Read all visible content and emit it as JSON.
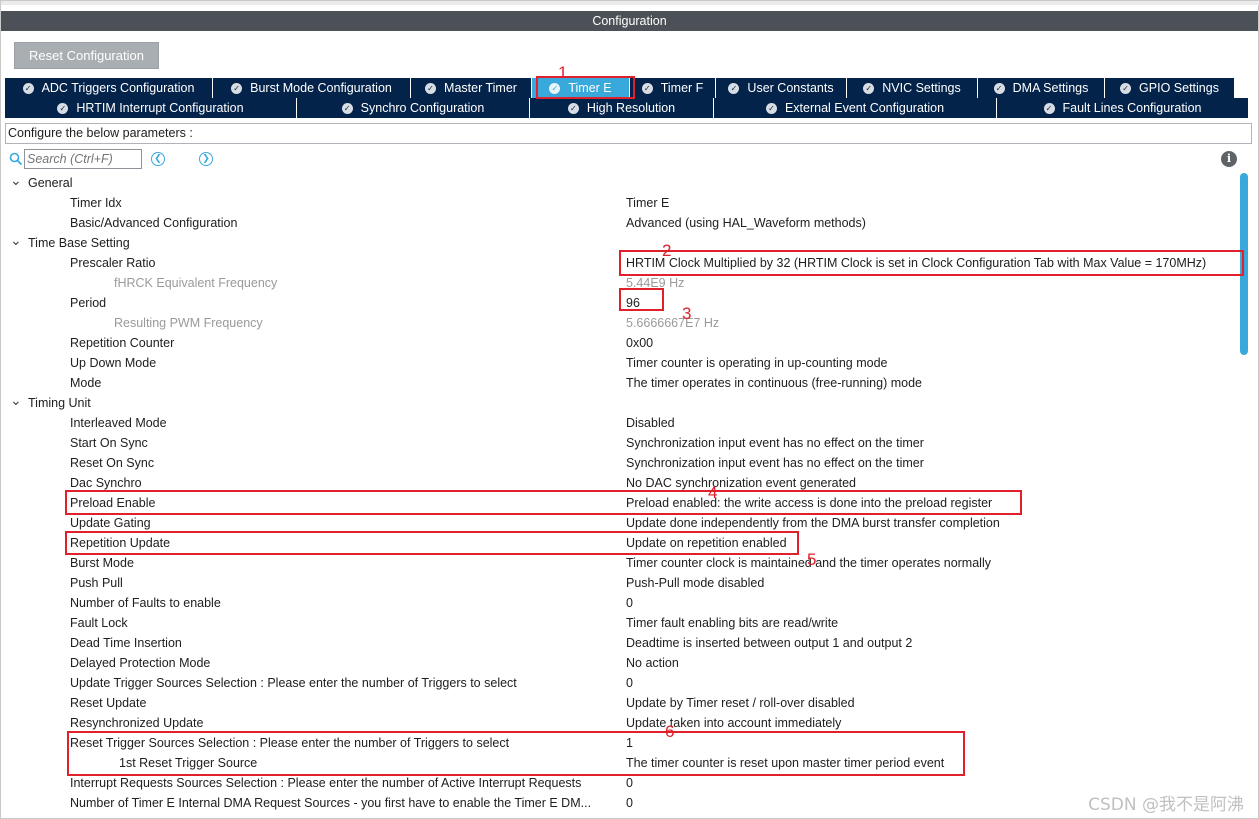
{
  "window": {
    "title": "Configuration"
  },
  "toolbar": {
    "reset_label": "Reset Configuration"
  },
  "tabs_row1": [
    {
      "label": "ADC Triggers Configuration",
      "w": 208,
      "active": false
    },
    {
      "label": "Burst Mode Configuration",
      "w": 198,
      "active": false
    },
    {
      "label": "Master Timer",
      "w": 121,
      "active": false
    },
    {
      "label": "Timer E",
      "w": 98,
      "active": true
    },
    {
      "label": "Timer F",
      "w": 86,
      "active": false
    },
    {
      "label": "User Constants",
      "w": 131,
      "active": false
    },
    {
      "label": "NVIC Settings",
      "w": 131,
      "active": false
    },
    {
      "label": "DMA Settings",
      "w": 127,
      "active": false
    },
    {
      "label": "GPIO Settings",
      "w": 130,
      "active": false
    }
  ],
  "tabs_row2": [
    {
      "label": "HRTIM Interrupt Configuration",
      "w": 292
    },
    {
      "label": "Synchro Configuration",
      "w": 233
    },
    {
      "label": "High Resolution",
      "w": 184
    },
    {
      "label": "External Event Configuration",
      "w": 283
    },
    {
      "label": "Fault Lines Configuration",
      "w": 252
    }
  ],
  "configure_text": "Configure the below parameters :",
  "search": {
    "placeholder": "Search (Ctrl+F)"
  },
  "icons": {
    "back": "chevron-left-icon",
    "forward": "chevron-right-icon",
    "info": "info-icon",
    "search": "search-icon",
    "check": "check-icon"
  },
  "colors": {
    "tab_bg": "#03234b",
    "tab_active": "#39a9dc",
    "title_bg": "#4b5157",
    "annotation": "#e0202a"
  },
  "rows": [
    {
      "type": "group",
      "label": "General"
    },
    {
      "type": "param",
      "level": 1,
      "label": "Timer Idx",
      "value": "Timer E"
    },
    {
      "type": "param",
      "level": 1,
      "label": "Basic/Advanced Configuration",
      "value": "Advanced (using HAL_Waveform methods)"
    },
    {
      "type": "group",
      "label": "Time Base Setting"
    },
    {
      "type": "param",
      "level": 1,
      "label": "Prescaler Ratio",
      "value": "HRTIM Clock Multiplied by 32 (HRTIM Clock is set in Clock Configuration Tab with Max Value = 170MHz)"
    },
    {
      "type": "param",
      "level": 2,
      "grey": true,
      "label": "fHRCK Equivalent Frequency",
      "value": "5.44E9 Hz"
    },
    {
      "type": "param",
      "level": 1,
      "label": "Period",
      "value": "96"
    },
    {
      "type": "param",
      "level": 2,
      "grey": true,
      "label": "Resulting PWM Frequency",
      "value": "5.6666667E7 Hz"
    },
    {
      "type": "param",
      "level": 1,
      "label": "Repetition Counter",
      "value": "0x00"
    },
    {
      "type": "param",
      "level": 1,
      "label": "Up Down Mode",
      "value": "Timer counter is operating in up-counting mode"
    },
    {
      "type": "param",
      "level": 1,
      "label": "Mode",
      "value": "The timer operates in continuous (free-running) mode"
    },
    {
      "type": "group",
      "label": "Timing Unit"
    },
    {
      "type": "param",
      "level": 1,
      "label": "Interleaved Mode",
      "value": "Disabled"
    },
    {
      "type": "param",
      "level": 1,
      "label": "Start On Sync",
      "value": "Synchronization input event has no effect on the timer"
    },
    {
      "type": "param",
      "level": 1,
      "label": "Reset On Sync",
      "value": "Synchronization input event has no effect on the timer"
    },
    {
      "type": "param",
      "level": 1,
      "label": "Dac Synchro",
      "value": "No DAC synchronization event generated"
    },
    {
      "type": "param",
      "level": 1,
      "label": "Preload Enable",
      "value": "Preload enabled: the write access is done into the preload register"
    },
    {
      "type": "param",
      "level": 1,
      "label": "Update Gating",
      "value": "Update done independently from the DMA burst transfer completion"
    },
    {
      "type": "param",
      "level": 1,
      "label": "Repetition Update",
      "value": "Update on repetition enabled"
    },
    {
      "type": "param",
      "level": 1,
      "label": "Burst Mode",
      "value": "Timer counter clock is maintained and the timer operates normally"
    },
    {
      "type": "param",
      "level": 1,
      "label": "Push Pull",
      "value": "Push-Pull mode disabled"
    },
    {
      "type": "param",
      "level": 1,
      "label": "Number of Faults to enable",
      "value": "0"
    },
    {
      "type": "param",
      "level": 1,
      "label": "Fault Lock",
      "value": "Timer fault enabling bits are read/write"
    },
    {
      "type": "param",
      "level": 1,
      "label": "Dead Time Insertion",
      "value": "Deadtime is inserted between output 1 and output 2"
    },
    {
      "type": "param",
      "level": 1,
      "label": "Delayed Protection Mode",
      "value": "No action"
    },
    {
      "type": "param",
      "level": 1,
      "label": "Update Trigger Sources Selection : Please enter the number of Triggers to select",
      "value": "0"
    },
    {
      "type": "param",
      "level": 1,
      "label": "Reset Update",
      "value": "Update by Timer reset / roll-over disabled"
    },
    {
      "type": "param",
      "level": 1,
      "label": "Resynchronized Update",
      "value": "Update taken into account immediately"
    },
    {
      "type": "param",
      "level": 1,
      "label": "Reset Trigger Sources Selection : Please enter the number of Triggers to select",
      "value": "1"
    },
    {
      "type": "param",
      "level": 2,
      "label": "1st Reset Trigger Source",
      "value": "The timer counter is reset upon master timer period event"
    },
    {
      "type": "param",
      "level": 1,
      "label": "Interrupt Requests Sources Selection : Please enter the number of Active Interrupt Requests",
      "value": "0"
    },
    {
      "type": "param",
      "level": 1,
      "label": "Number of Timer E Internal DMA Request Sources  - you first have to enable the Timer E DM...",
      "value": "0"
    }
  ],
  "annotations": [
    "1",
    "2",
    "3",
    "4",
    "5",
    "6"
  ],
  "watermark": "CSDN @我不是阿沸"
}
